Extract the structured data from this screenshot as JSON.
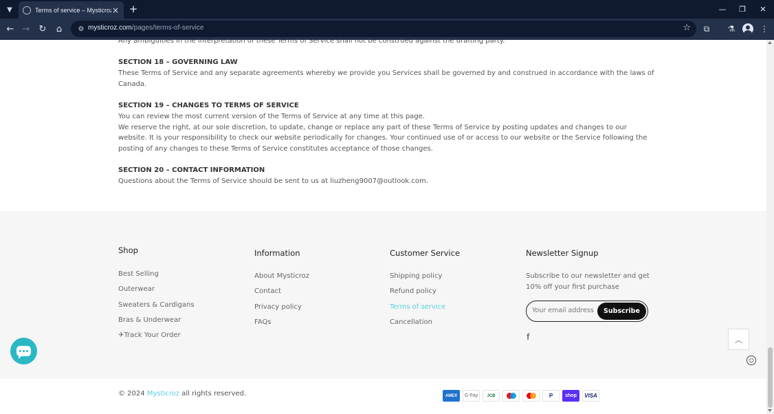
{
  "browser": {
    "tab_title": "Terms of service – Mysticroz",
    "url_domain": "mysticroz.com",
    "url_path": "/pages/terms-of-service"
  },
  "page": {
    "paragraphs": [
      {
        "kind": "body",
        "text": "Any ambiguities in the interpretation of these Terms of Service shall not be construed against the drafting party."
      },
      {
        "kind": "title",
        "text": "SECTION 18 – GOVERNING LAW"
      },
      {
        "kind": "body",
        "text": "These Terms of Service and any separate agreements whereby we provide you Services shall be governed by and construed in accordance with the laws of Canada."
      },
      {
        "kind": "title",
        "text": "SECTION 19 – CHANGES TO TERMS OF SERVICE"
      },
      {
        "kind": "body",
        "text": "You can review the most current version of the Terms of Service at any time at this page."
      },
      {
        "kind": "body",
        "text": "We reserve the right, at our sole discretion, to update, change or replace any part of these Terms of Service by posting updates and changes to our website. It is your responsibility to check our website periodically for changes. Your continued use of or access to our website or the Service following the posting of any changes to these Terms of Service constitutes acceptance of those changes."
      },
      {
        "kind": "title",
        "text": "SECTION 20 – CONTACT INFORMATION"
      },
      {
        "kind": "body",
        "text": "Questions about the Terms of Service should be sent to us at liuzheng9007@outlook.com."
      }
    ]
  },
  "footer": {
    "shop": {
      "title": "Shop",
      "links": [
        "Best Selling",
        "Outerwear",
        "Sweaters & Cardigans",
        "Bras & Underwear",
        "✈Track Your Order"
      ]
    },
    "information": {
      "title": "Information",
      "links": [
        "About Mysticroz",
        "Contact",
        "Privacy policy",
        "FAQs"
      ]
    },
    "customer_service": {
      "title": "Customer Service",
      "links": [
        "Shipping policy",
        "Refund policy",
        "Terms of service",
        "Cancellation"
      ],
      "active_index": 2
    },
    "newsletter": {
      "title": "Newsletter Signup",
      "text": "Subscribe to our newsletter and get 10% off your first purchase",
      "placeholder": "Your email address",
      "button": "Subscribe"
    },
    "social": {
      "facebook": "f"
    },
    "copyright_prefix": "© 2024 ",
    "brand": "Mysticroz",
    "copyright_suffix": " all rights reserved.",
    "payments": [
      {
        "name": "amex-icon",
        "label": "AMEX"
      },
      {
        "name": "google-pay-icon",
        "label": "G Pay"
      },
      {
        "name": "jcb-icon",
        "label": "JCB"
      },
      {
        "name": "maestro-icon",
        "label": ""
      },
      {
        "name": "mastercard-icon",
        "label": ""
      },
      {
        "name": "paypal-icon",
        "label": "P"
      },
      {
        "name": "shop-pay-icon",
        "label": "shop"
      },
      {
        "name": "visa-icon",
        "label": "VISA"
      }
    ]
  },
  "colors": {
    "accent": "#56cfe1",
    "chat": "#2bb7c4",
    "footer_bg": "#f6f6f6"
  }
}
